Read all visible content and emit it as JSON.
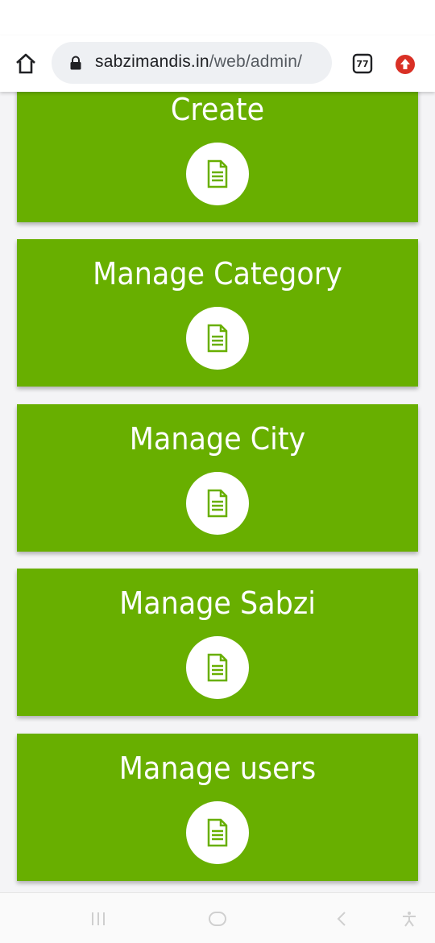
{
  "browser": {
    "url_host": "sabzimandis.in",
    "url_path": "/web/admin/",
    "tab_count": "77"
  },
  "cards": [
    {
      "title": "Create",
      "icon": "document-icon"
    },
    {
      "title": "Manage Category",
      "icon": "document-icon"
    },
    {
      "title": "Manage City",
      "icon": "document-icon"
    },
    {
      "title": "Manage Sabzi",
      "icon": "document-icon"
    },
    {
      "title": "Manage users",
      "icon": "document-icon"
    }
  ],
  "colors": {
    "card_green": "#68af00",
    "update_red": "#d93025"
  },
  "system_nav": {
    "icons": [
      "recents-icon",
      "home-circle-icon",
      "back-icon",
      "accessibility-icon"
    ]
  }
}
